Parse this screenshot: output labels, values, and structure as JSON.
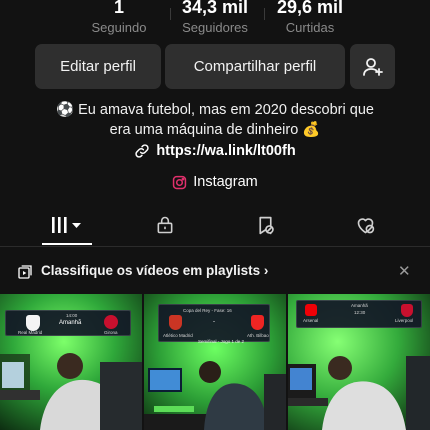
{
  "stats": [
    {
      "value": "1",
      "label": "Seguindo"
    },
    {
      "value": "34,3 mil",
      "label": "Seguidores"
    },
    {
      "value": "29,6 mil",
      "label": "Curtidas"
    }
  ],
  "actions": {
    "edit_label": "Editar perfil",
    "share_label": "Compartilhar perfil",
    "add_friend_icon": "add-user-icon"
  },
  "bio": {
    "line1": "⚽ Eu amava futebol, mas em 2020 descobri que",
    "line2": "era uma máquina de dinheiro 💰"
  },
  "link": {
    "text": "https://wa.link/lt00fh",
    "icon": "link-icon"
  },
  "social": {
    "label": "Instagram",
    "icon": "instagram-icon",
    "color": "#e1306c"
  },
  "tabs": [
    {
      "name": "videos",
      "icon": "grid-icon",
      "active": true
    },
    {
      "name": "private",
      "icon": "lock-icon"
    },
    {
      "name": "favorites",
      "icon": "bookmark-hidden-icon"
    },
    {
      "name": "liked",
      "icon": "heart-hidden-icon"
    }
  ],
  "playlist_banner": {
    "text": "Classifique os vídeos em playlists",
    "chevron": "›",
    "close": "✕"
  },
  "videos": [
    {
      "home": "Real Madrid",
      "status": "Amanhã",
      "time": "14:00",
      "away": "Girona"
    },
    {
      "league": "Copa del Rey - Fase: 16",
      "home": "Atlético Madrid",
      "score": "-",
      "away": "Ath. Bilbao",
      "footer": "Semifinal - Jogo 1 de 2"
    },
    {
      "home": "Arsenal",
      "status": "Amanhã",
      "time": "12:30",
      "away": "Liverpool"
    }
  ],
  "colors": {
    "background": "#121212",
    "button": "#2f2f2f",
    "muted": "#8a8a8a",
    "accent_green": "#39d14a"
  }
}
